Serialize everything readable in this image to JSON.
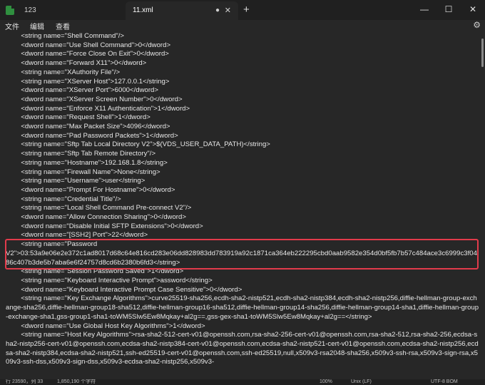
{
  "window": {
    "tabs": [
      {
        "label": "123"
      },
      {
        "label": "11.xml"
      }
    ],
    "new_tab": "+",
    "controls": {
      "minimize": "—",
      "maximize": "☐",
      "close": "✕"
    }
  },
  "menu": {
    "file": "文件",
    "edit": "编辑",
    "view": "查看"
  },
  "editor": {
    "text": "        <string name=\"Shell Command\"/>\n        <dword name=\"Use Shell Command\">0</dword>\n        <dword name=\"Force Close On Exit\">0</dword>\n        <dword name=\"Forward X11\">0</dword>\n        <string name=\"XAuthority File\"/>\n        <string name=\"XServer Host\">127.0.0.1</string>\n        <dword name=\"XServer Port\">6000</dword>\n        <dword name=\"XServer Screen Number\">0</dword>\n        <dword name=\"Enforce X11 Authentication\">1</dword>\n        <dword name=\"Request Shell\">1</dword>\n        <dword name=\"Max Packet Size\">4096</dword>\n        <dword name=\"Pad Password Packets\">1</dword>\n        <string name=\"Sftp Tab Local Directory V2\">$(VDS_USER_DATA_PATH)</string>\n        <string name=\"Sftp Tab Remote Directory\"/>\n        <string name=\"Hostname\">192.168.1.8</string>\n        <string name=\"Firewall Name\">None</string>\n        <string name=\"Username\">user</string>\n        <dword name=\"Prompt For Hostname\">0</dword>\n        <string name=\"Credential Title\"/>\n        <string name=\"Local Shell Command Pre-connect V2\"/>\n        <dword name=\"Allow Connection Sharing\">0</dword>\n        <dword name=\"Disable Initial SFTP Extensions\">0</dword>\n        <dword name=\"[SSH2] Port\">22</dword>\n        <string name=\"Password\nV2\">03:53a9e06e2e372c1ad8017d68c64e816cd283e06dd828983dd783919a92c1871ca364eb222295cbd0aab9582e354d0bf5fb7b57c484ace3c6999c3f0486c407b3de5b7aba6e6f24757d8cd6b2380b6fd3</string>\n        <string name=\"Session Password Saved\">1</dword>\n        <string name=\"Keyboard Interactive Prompt\">assword</string>\n        <dword name=\"Keyboard Interactive Prompt Case Sensitive\">0</dword>\n        <string name=\"Key Exchange Algorithms\">curve25519-sha256,ecdh-sha2-nistp521,ecdh-sha2-nistp384,ecdh-sha2-nistp256,diffie-hellman-group-exchange-sha256,diffie-hellman-group18-sha512,diffie-hellman-group16-sha512,diffie-hellman-group14-sha256,diffie-hellman-group14-sha1,diffie-hellman-group-exchange-sha1,gss-group1-sha1-toWM5Slw5Ew8Mqkay+al2g==,gss-gex-sha1-toWM5Slw5Ew8Mqkay+al2g==</string>\n        <dword name=\"Use Global Host Key Algorithms\">1</dword>\n        <string name=\"Host Key Algorithms\">rsa-sha2-512-cert-v01@openssh.com,rsa-sha2-256-cert-v01@openssh.com,rsa-sha2-512,rsa-sha2-256,ecdsa-sha2-nistp256-cert-v01@openssh.com,ecdsa-sha2-nistp384-cert-v01@openssh.com,ecdsa-sha2-nistp521-cert-v01@openssh.com,ecdsa-sha2-nistp256,ecdsa-sha2-nistp384,ecdsa-sha2-nistp521,ssh-ed25519-cert-v01@openssh.com,ssh-ed25519,null,x509v3-rsa2048-sha256,x509v3-ssh-rsa,x509v3-sign-rsa,x509v3-ssh-dss,x509v3-sign-dss,x509v3-ecdsa-sha2-nistp256,x509v3-"
  },
  "status": {
    "position": "行 23590，列 33",
    "chars": "1,850,190 个字符",
    "zoom": "100%",
    "line_ending": "Unix (LF)",
    "encoding": "UTF-8 BOM"
  },
  "colors": {
    "highlight": "#e23b4b",
    "background": "#272727",
    "titlebar": "#202020"
  }
}
